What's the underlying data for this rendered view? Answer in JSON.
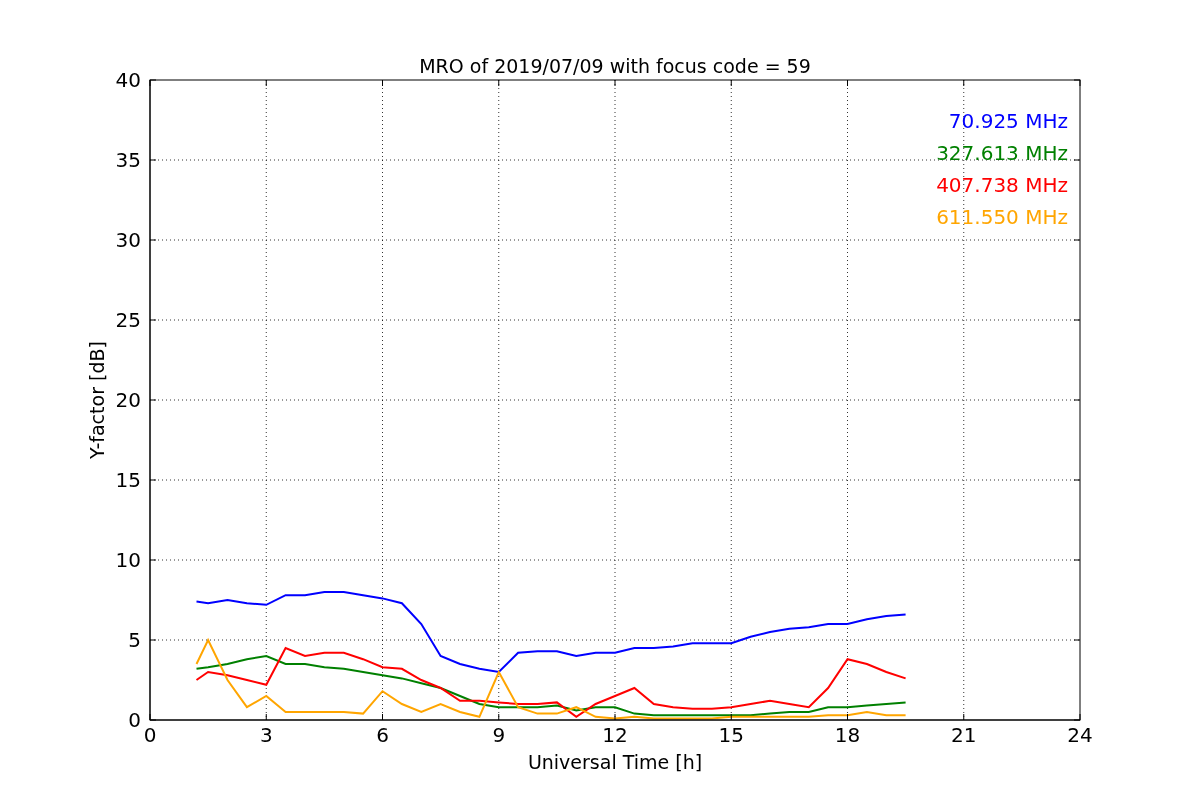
{
  "chart_data": {
    "type": "line",
    "title": "MRO of 2019/07/09 with focus code = 59",
    "xlabel": "Universal Time [h]",
    "ylabel": "Y-factor [dB]",
    "x": [
      1.2,
      1.5,
      2,
      2.5,
      3,
      3.5,
      4,
      4.5,
      5,
      5.5,
      6,
      6.5,
      7,
      7.5,
      8,
      8.5,
      9,
      9.5,
      10,
      10.5,
      11,
      11.5,
      12,
      12.5,
      13,
      13.5,
      14,
      14.5,
      15,
      15.5,
      16,
      16.5,
      17,
      17.5,
      18,
      18.5,
      19,
      19.5
    ],
    "series": [
      {
        "name": "70.925 MHz",
        "color": "#0000ff",
        "values": [
          7.4,
          7.3,
          7.5,
          7.3,
          7.2,
          7.8,
          7.8,
          8.0,
          8.0,
          7.8,
          7.6,
          7.3,
          6.0,
          4.0,
          3.5,
          3.2,
          3.0,
          4.2,
          4.3,
          4.3,
          4.0,
          4.2,
          4.2,
          4.5,
          4.5,
          4.6,
          4.8,
          4.8,
          4.8,
          5.2,
          5.5,
          5.7,
          5.8,
          6.0,
          6.0,
          6.3,
          6.5,
          6.6
        ]
      },
      {
        "name": "327.613 MHz",
        "color": "#008000",
        "values": [
          3.2,
          3.3,
          3.5,
          3.8,
          4.0,
          3.5,
          3.5,
          3.3,
          3.2,
          3.0,
          2.8,
          2.6,
          2.3,
          2.0,
          1.5,
          1.0,
          0.8,
          0.8,
          0.8,
          0.9,
          0.6,
          0.8,
          0.8,
          0.4,
          0.3,
          0.3,
          0.3,
          0.3,
          0.3,
          0.3,
          0.4,
          0.5,
          0.5,
          0.8,
          0.8,
          0.9,
          1.0,
          1.1
        ]
      },
      {
        "name": "407.738 MHz",
        "color": "#ff0000",
        "values": [
          2.5,
          3.0,
          2.8,
          2.5,
          2.2,
          4.5,
          4.0,
          4.2,
          4.2,
          3.8,
          3.3,
          3.2,
          2.5,
          2.0,
          1.2,
          1.2,
          1.1,
          1.0,
          1.0,
          1.1,
          0.2,
          1.0,
          1.5,
          2.0,
          1.0,
          0.8,
          0.7,
          0.7,
          0.8,
          1.0,
          1.2,
          1.0,
          0.8,
          2.0,
          3.8,
          3.5,
          3.0,
          2.6
        ]
      },
      {
        "name": "611.550 MHz",
        "color": "#ffa500",
        "values": [
          3.5,
          5.0,
          2.5,
          0.8,
          1.5,
          0.5,
          0.5,
          0.5,
          0.5,
          0.4,
          1.8,
          1.0,
          0.5,
          1.0,
          0.5,
          0.2,
          3.0,
          0.8,
          0.4,
          0.4,
          0.8,
          0.2,
          0.1,
          0.2,
          0.1,
          0.1,
          0.1,
          0.1,
          0.2,
          0.2,
          0.2,
          0.2,
          0.2,
          0.3,
          0.3,
          0.5,
          0.3,
          0.3
        ]
      }
    ],
    "grid": true,
    "xlim": [
      0,
      24
    ],
    "ylim": [
      0,
      40
    ],
    "xticks": [
      0,
      3,
      6,
      9,
      12,
      15,
      18,
      21,
      24
    ],
    "yticks": [
      0,
      5,
      10,
      15,
      20,
      25,
      30,
      35,
      40
    ]
  }
}
